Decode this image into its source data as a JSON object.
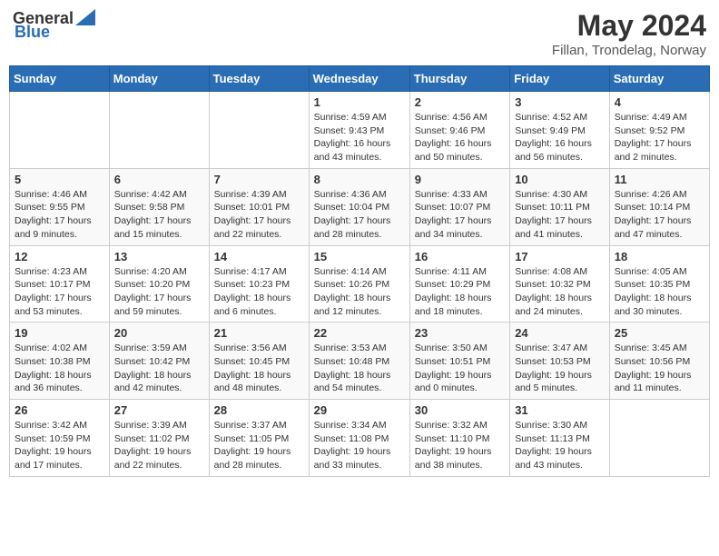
{
  "header": {
    "logo_general": "General",
    "logo_blue": "Blue",
    "month": "May 2024",
    "location": "Fillan, Trondelag, Norway"
  },
  "weekdays": [
    "Sunday",
    "Monday",
    "Tuesday",
    "Wednesday",
    "Thursday",
    "Friday",
    "Saturday"
  ],
  "weeks": [
    [
      {
        "day": "",
        "info": ""
      },
      {
        "day": "",
        "info": ""
      },
      {
        "day": "",
        "info": ""
      },
      {
        "day": "1",
        "info": "Sunrise: 4:59 AM\nSunset: 9:43 PM\nDaylight: 16 hours\nand 43 minutes."
      },
      {
        "day": "2",
        "info": "Sunrise: 4:56 AM\nSunset: 9:46 PM\nDaylight: 16 hours\nand 50 minutes."
      },
      {
        "day": "3",
        "info": "Sunrise: 4:52 AM\nSunset: 9:49 PM\nDaylight: 16 hours\nand 56 minutes."
      },
      {
        "day": "4",
        "info": "Sunrise: 4:49 AM\nSunset: 9:52 PM\nDaylight: 17 hours\nand 2 minutes."
      }
    ],
    [
      {
        "day": "5",
        "info": "Sunrise: 4:46 AM\nSunset: 9:55 PM\nDaylight: 17 hours\nand 9 minutes."
      },
      {
        "day": "6",
        "info": "Sunrise: 4:42 AM\nSunset: 9:58 PM\nDaylight: 17 hours\nand 15 minutes."
      },
      {
        "day": "7",
        "info": "Sunrise: 4:39 AM\nSunset: 10:01 PM\nDaylight: 17 hours\nand 22 minutes."
      },
      {
        "day": "8",
        "info": "Sunrise: 4:36 AM\nSunset: 10:04 PM\nDaylight: 17 hours\nand 28 minutes."
      },
      {
        "day": "9",
        "info": "Sunrise: 4:33 AM\nSunset: 10:07 PM\nDaylight: 17 hours\nand 34 minutes."
      },
      {
        "day": "10",
        "info": "Sunrise: 4:30 AM\nSunset: 10:11 PM\nDaylight: 17 hours\nand 41 minutes."
      },
      {
        "day": "11",
        "info": "Sunrise: 4:26 AM\nSunset: 10:14 PM\nDaylight: 17 hours\nand 47 minutes."
      }
    ],
    [
      {
        "day": "12",
        "info": "Sunrise: 4:23 AM\nSunset: 10:17 PM\nDaylight: 17 hours\nand 53 minutes."
      },
      {
        "day": "13",
        "info": "Sunrise: 4:20 AM\nSunset: 10:20 PM\nDaylight: 17 hours\nand 59 minutes."
      },
      {
        "day": "14",
        "info": "Sunrise: 4:17 AM\nSunset: 10:23 PM\nDaylight: 18 hours\nand 6 minutes."
      },
      {
        "day": "15",
        "info": "Sunrise: 4:14 AM\nSunset: 10:26 PM\nDaylight: 18 hours\nand 12 minutes."
      },
      {
        "day": "16",
        "info": "Sunrise: 4:11 AM\nSunset: 10:29 PM\nDaylight: 18 hours\nand 18 minutes."
      },
      {
        "day": "17",
        "info": "Sunrise: 4:08 AM\nSunset: 10:32 PM\nDaylight: 18 hours\nand 24 minutes."
      },
      {
        "day": "18",
        "info": "Sunrise: 4:05 AM\nSunset: 10:35 PM\nDaylight: 18 hours\nand 30 minutes."
      }
    ],
    [
      {
        "day": "19",
        "info": "Sunrise: 4:02 AM\nSunset: 10:38 PM\nDaylight: 18 hours\nand 36 minutes."
      },
      {
        "day": "20",
        "info": "Sunrise: 3:59 AM\nSunset: 10:42 PM\nDaylight: 18 hours\nand 42 minutes."
      },
      {
        "day": "21",
        "info": "Sunrise: 3:56 AM\nSunset: 10:45 PM\nDaylight: 18 hours\nand 48 minutes."
      },
      {
        "day": "22",
        "info": "Sunrise: 3:53 AM\nSunset: 10:48 PM\nDaylight: 18 hours\nand 54 minutes."
      },
      {
        "day": "23",
        "info": "Sunrise: 3:50 AM\nSunset: 10:51 PM\nDaylight: 19 hours\nand 0 minutes."
      },
      {
        "day": "24",
        "info": "Sunrise: 3:47 AM\nSunset: 10:53 PM\nDaylight: 19 hours\nand 5 minutes."
      },
      {
        "day": "25",
        "info": "Sunrise: 3:45 AM\nSunset: 10:56 PM\nDaylight: 19 hours\nand 11 minutes."
      }
    ],
    [
      {
        "day": "26",
        "info": "Sunrise: 3:42 AM\nSunset: 10:59 PM\nDaylight: 19 hours\nand 17 minutes."
      },
      {
        "day": "27",
        "info": "Sunrise: 3:39 AM\nSunset: 11:02 PM\nDaylight: 19 hours\nand 22 minutes."
      },
      {
        "day": "28",
        "info": "Sunrise: 3:37 AM\nSunset: 11:05 PM\nDaylight: 19 hours\nand 28 minutes."
      },
      {
        "day": "29",
        "info": "Sunrise: 3:34 AM\nSunset: 11:08 PM\nDaylight: 19 hours\nand 33 minutes."
      },
      {
        "day": "30",
        "info": "Sunrise: 3:32 AM\nSunset: 11:10 PM\nDaylight: 19 hours\nand 38 minutes."
      },
      {
        "day": "31",
        "info": "Sunrise: 3:30 AM\nSunset: 11:13 PM\nDaylight: 19 hours\nand 43 minutes."
      },
      {
        "day": "",
        "info": ""
      }
    ]
  ]
}
